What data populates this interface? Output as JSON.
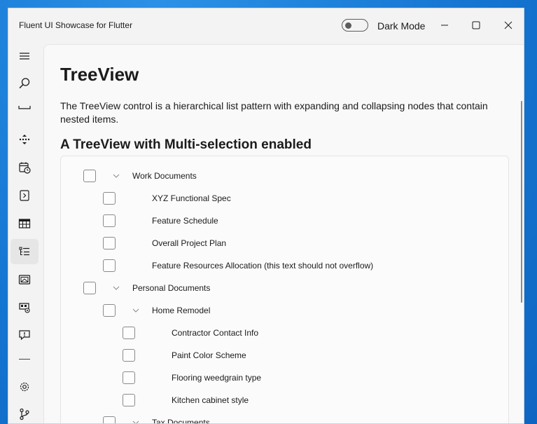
{
  "window": {
    "title": "Fluent UI Showcase for Flutter",
    "dark_mode_label": "Dark Mode",
    "dark_mode_on": false
  },
  "nav": {
    "items": [
      {
        "icon": "hamburger-menu-icon"
      },
      {
        "icon": "search-icon"
      },
      {
        "icon": "partial-icon"
      },
      {
        "icon": "flip-view-icon"
      },
      {
        "icon": "calendar-clock-icon"
      },
      {
        "icon": "expander-icon"
      },
      {
        "icon": "table-icon"
      },
      {
        "icon": "tree-view-icon",
        "selected": true
      },
      {
        "icon": "image-icon"
      },
      {
        "icon": "ribbon-icon"
      },
      {
        "icon": "feedback-icon"
      },
      {
        "icon": "settings-icon"
      },
      {
        "icon": "branch-icon"
      }
    ]
  },
  "page": {
    "title": "TreeView",
    "description": "The TreeView control is a hierarchical list pattern with expanding and collapsing nodes that contain nested items.",
    "section_title": "A TreeView with Multi-selection enabled"
  },
  "tree": {
    "rows": [
      {
        "label": "Work Documents",
        "level": 0,
        "expandable": true,
        "expanded": true
      },
      {
        "label": "XYZ Functional Spec",
        "level": 1,
        "expandable": false
      },
      {
        "label": "Feature Schedule",
        "level": 1,
        "expandable": false
      },
      {
        "label": "Overall Project Plan",
        "level": 1,
        "expandable": false
      },
      {
        "label": "Feature Resources Allocation (this text should not overflow)",
        "level": 1,
        "expandable": false
      },
      {
        "label": "Personal Documents",
        "level": 0,
        "expandable": true,
        "expanded": true
      },
      {
        "label": "Home Remodel",
        "level": 1,
        "expandable": true,
        "expanded": true
      },
      {
        "label": "Contractor Contact Info",
        "level": 2,
        "expandable": false
      },
      {
        "label": "Paint Color Scheme",
        "level": 2,
        "expandable": false
      },
      {
        "label": "Flooring weedgrain type",
        "level": 2,
        "expandable": false
      },
      {
        "label": "Kitchen cabinet style",
        "level": 2,
        "expandable": false
      },
      {
        "label": "Tax Documents",
        "level": 1,
        "expandable": true,
        "expanded": true
      }
    ]
  },
  "colors": {
    "accent": "#0067c0",
    "desktop": "#1478d4"
  }
}
